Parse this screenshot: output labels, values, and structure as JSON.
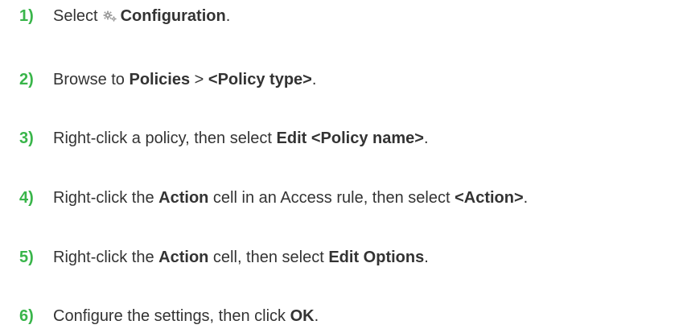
{
  "accent_color": "#39b54a",
  "steps": [
    {
      "number": "1)",
      "parts": [
        {
          "text": "Select",
          "bold": false
        },
        {
          "icon": "gear-icon"
        },
        {
          "text": "Configuration",
          "bold": true
        },
        {
          "text": ".",
          "bold": false
        }
      ]
    },
    {
      "number": "2)",
      "parts": [
        {
          "text": "Browse to ",
          "bold": false
        },
        {
          "text": "Policies",
          "bold": true
        },
        {
          "text": " > ",
          "bold": false
        },
        {
          "text": "<Policy type>",
          "bold": true
        },
        {
          "text": ".",
          "bold": false
        }
      ]
    },
    {
      "number": "3)",
      "parts": [
        {
          "text": "Right-click a policy, then select ",
          "bold": false
        },
        {
          "text": "Edit <Policy name>",
          "bold": true
        },
        {
          "text": ".",
          "bold": false
        }
      ]
    },
    {
      "number": "4)",
      "parts": [
        {
          "text": "Right-click the ",
          "bold": false
        },
        {
          "text": "Action",
          "bold": true
        },
        {
          "text": " cell in an Access rule, then select ",
          "bold": false
        },
        {
          "text": "<Action>",
          "bold": true
        },
        {
          "text": ".",
          "bold": false
        }
      ]
    },
    {
      "number": "5)",
      "parts": [
        {
          "text": "Right-click the ",
          "bold": false
        },
        {
          "text": "Action",
          "bold": true
        },
        {
          "text": " cell, then select ",
          "bold": false
        },
        {
          "text": "Edit Options",
          "bold": true
        },
        {
          "text": ".",
          "bold": false
        }
      ]
    },
    {
      "number": "6)",
      "parts": [
        {
          "text": "Configure the settings, then click ",
          "bold": false
        },
        {
          "text": "OK",
          "bold": true
        },
        {
          "text": ".",
          "bold": false
        }
      ]
    }
  ]
}
